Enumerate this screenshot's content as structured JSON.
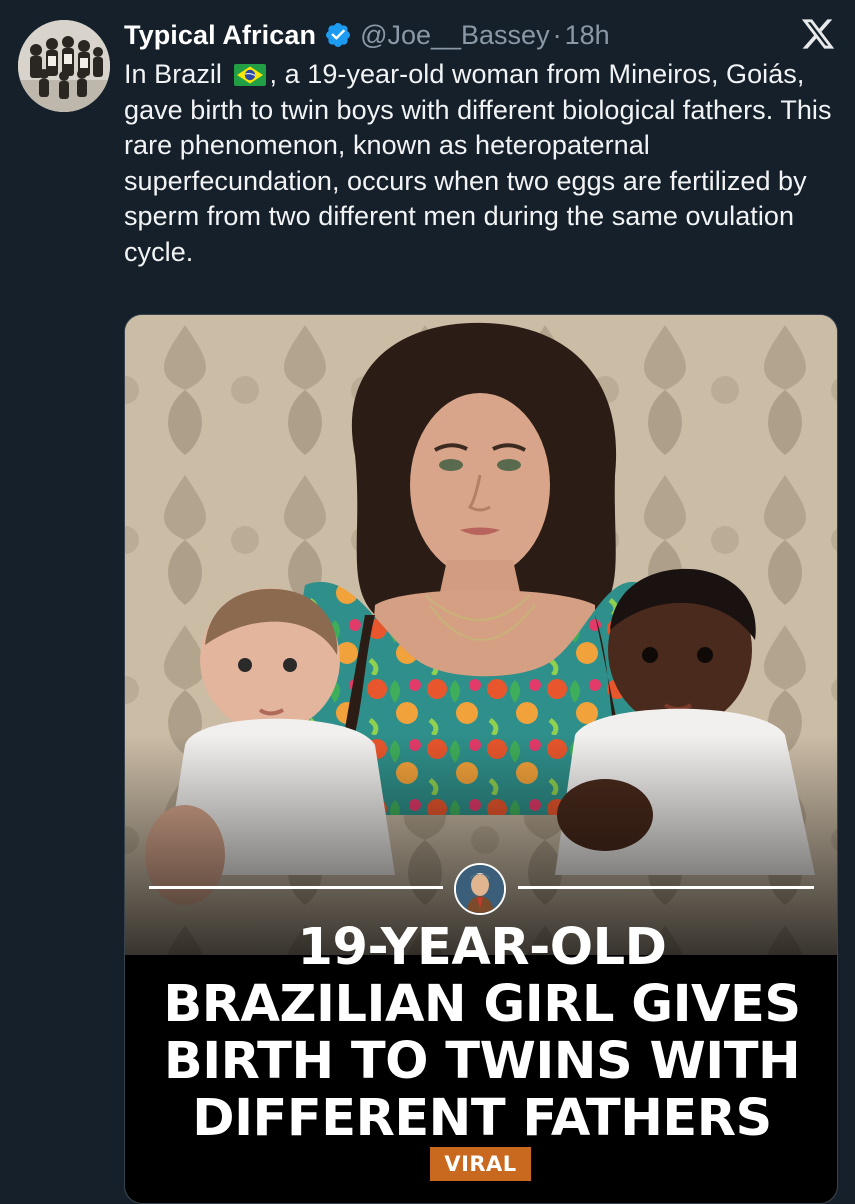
{
  "tweet": {
    "display_name": "Typical African",
    "handle": "@Joe__Bassey",
    "separator": "·",
    "time": "18h",
    "text_before_flag": "In Brazil",
    "flag_icon": "brazil-flag-icon",
    "text_after_flag": ", a 19-year-old woman from Mineiros, Goiás, gave birth to twin boys with different biological fathers. This rare phenomenon, known as heteropaternal superfecundation, occurs when two eggs are fertilized by sperm from two different men during the same ovulation cycle."
  },
  "media": {
    "headline_lines": [
      "19-YEAR-OLD",
      "BRAZILIAN GIRL GIVES",
      "BIRTH TO TWINS WITH",
      "DIFFERENT FATHERS"
    ],
    "badge_label": "VIRAL"
  },
  "colors": {
    "background": "#15202b",
    "verified_blue": "#1d9bf0",
    "muted_text": "#8b98a5",
    "badge_orange": "#c8691f"
  }
}
